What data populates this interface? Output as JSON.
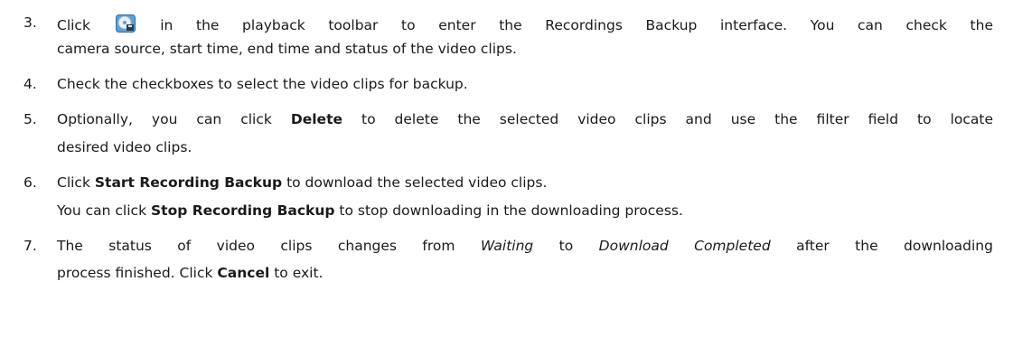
{
  "steps": [
    {
      "number": "3.",
      "parts": {
        "a": "Click",
        "b": "in the playback toolbar to enter the Recordings Backup interface. You can check the",
        "c": "camera source, start time, end time and status of the video clips."
      },
      "icon": "backup-disc-icon"
    },
    {
      "number": "4.",
      "parts": {
        "a": "Check the checkboxes to select the video clips for backup."
      }
    },
    {
      "number": "5.",
      "parts": {
        "a": "Optionally, you can click",
        "b": "Delete",
        "c": "to delete the selected video clips and use the filter field to locate",
        "d": "desired video clips."
      }
    },
    {
      "number": "6.",
      "parts": {
        "a": "Click",
        "b": "Start Recording Backup",
        "c": "to download the selected video clips.",
        "d": "You can click",
        "e": "Stop Recording Backup",
        "f": "to stop downloading in the downloading process."
      }
    },
    {
      "number": "7.",
      "parts": {
        "a": "The status of video clips changes from",
        "b": "Waiting",
        "c": "to",
        "d": "Download Completed",
        "e": "after the downloading",
        "f": "process finished. Click",
        "g": "Cancel",
        "h": "to exit."
      }
    }
  ]
}
